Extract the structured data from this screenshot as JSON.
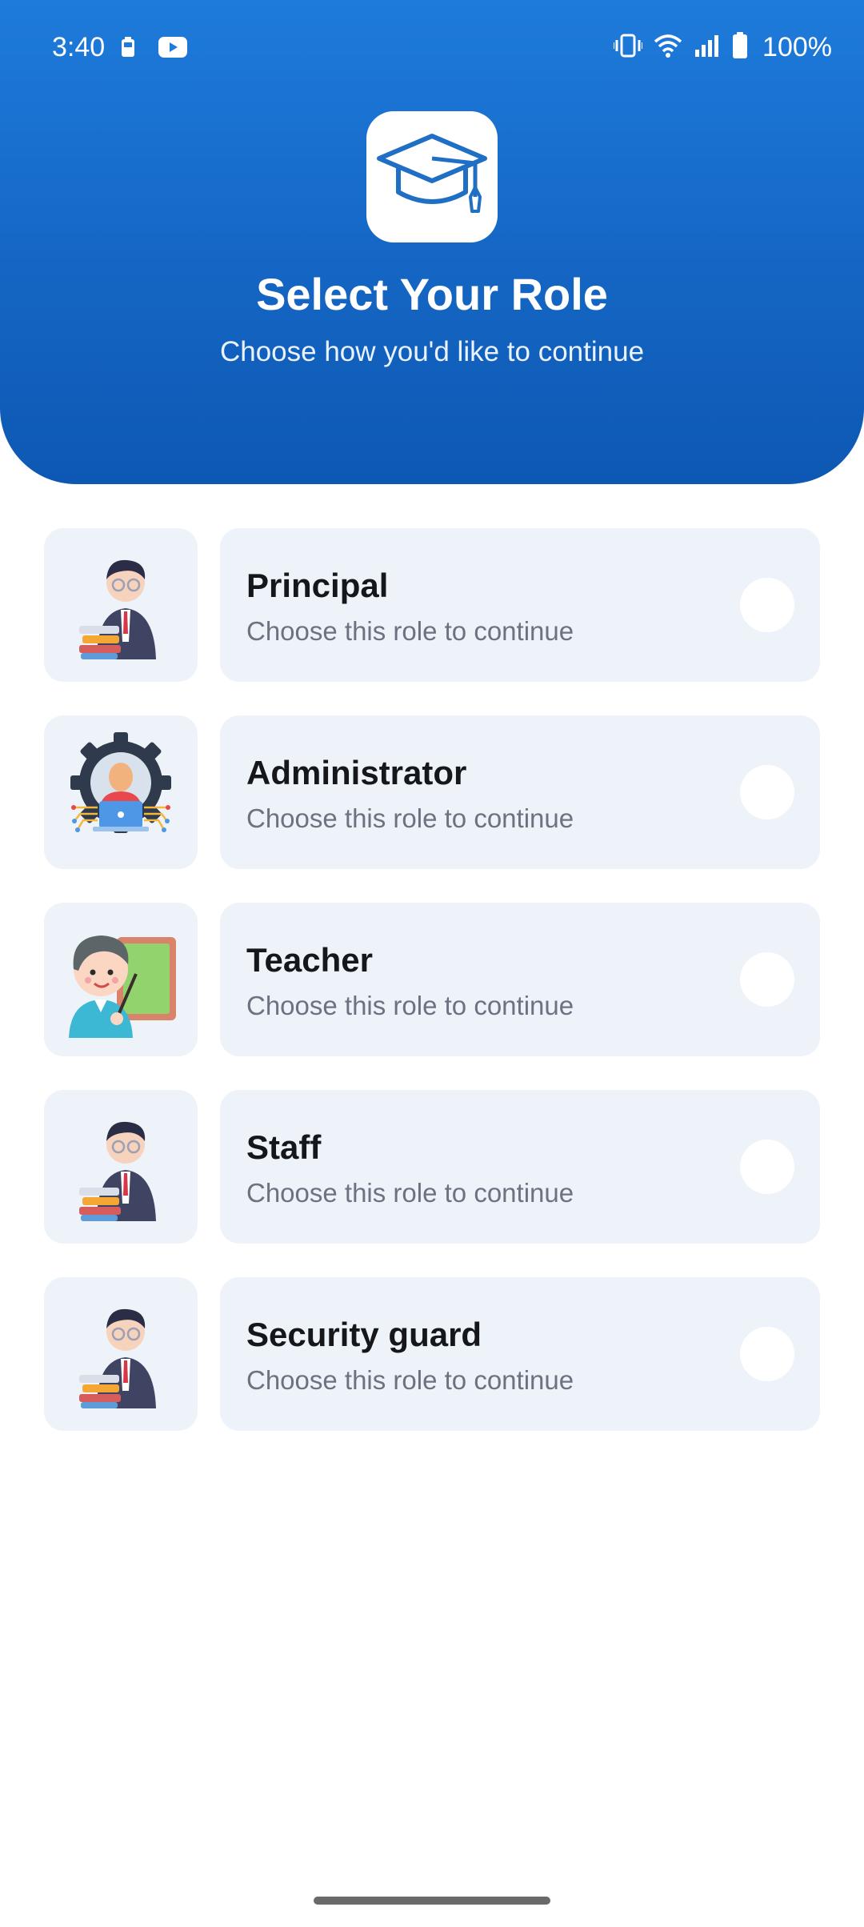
{
  "status_bar": {
    "time": "3:40",
    "battery_percent": "100%"
  },
  "header": {
    "app_icon": "graduation-cap-icon",
    "title": "Select Your Role",
    "subtitle": "Choose how you'd like to continue",
    "gradient_top": "#1E7BDB",
    "gradient_bottom": "#0D58B3"
  },
  "roles": [
    {
      "name": "Principal",
      "description": "Choose this role to continue",
      "illustration": "principal-avatar-icon",
      "selected": false
    },
    {
      "name": "Administrator",
      "description": "Choose this role to continue",
      "illustration": "administrator-avatar-icon",
      "selected": false
    },
    {
      "name": "Teacher",
      "description": "Choose this role to continue",
      "illustration": "teacher-avatar-icon",
      "selected": false
    },
    {
      "name": "Staff",
      "description": "Choose this role to continue",
      "illustration": "staff-avatar-icon",
      "selected": false
    },
    {
      "name": "Security guard",
      "description": "Choose this role to continue",
      "illustration": "security-guard-avatar-icon",
      "selected": false
    }
  ],
  "colors": {
    "card_background": "#EEF3FA",
    "title_text": "#15171A",
    "description_text": "#6B7280"
  }
}
